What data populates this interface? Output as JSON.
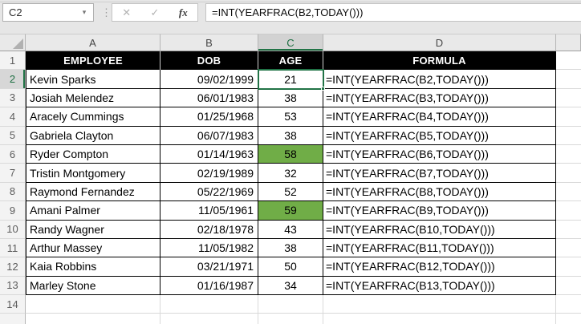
{
  "formula_bar": {
    "name_box_value": "C2",
    "formula": "=INT(YEARFRAC(B2,TODAY()))",
    "icons": {
      "dropdown": "▾",
      "dots": "⋮",
      "cancel": "✕",
      "enter": "✓",
      "fx": "fx"
    }
  },
  "sheet": {
    "selected_cell": "C2",
    "selected_column": "C",
    "selected_row": "2",
    "column_letters": [
      "A",
      "B",
      "C",
      "D"
    ],
    "header_row_number": "1",
    "table_headers": [
      "EMPLOYEE",
      "DOB",
      "AGE",
      "FORMULA"
    ],
    "rows": [
      {
        "n": "2",
        "name": "Kevin Sparks",
        "dob": "09/02/1999",
        "age": "21",
        "formula": "=INT(YEARFRAC(B2,TODAY()))",
        "highlighted": false,
        "selected": true
      },
      {
        "n": "3",
        "name": "Josiah Melendez",
        "dob": "06/01/1983",
        "age": "38",
        "formula": "=INT(YEARFRAC(B3,TODAY()))",
        "highlighted": false
      },
      {
        "n": "4",
        "name": "Aracely Cummings",
        "dob": "01/25/1968",
        "age": "53",
        "formula": "=INT(YEARFRAC(B4,TODAY()))",
        "highlighted": false
      },
      {
        "n": "5",
        "name": "Gabriela Clayton",
        "dob": "06/07/1983",
        "age": "38",
        "formula": "=INT(YEARFRAC(B5,TODAY()))",
        "highlighted": false
      },
      {
        "n": "6",
        "name": "Ryder Compton",
        "dob": "01/14/1963",
        "age": "58",
        "formula": "=INT(YEARFRAC(B6,TODAY()))",
        "highlighted": true
      },
      {
        "n": "7",
        "name": "Tristin Montgomery",
        "dob": "02/19/1989",
        "age": "32",
        "formula": "=INT(YEARFRAC(B7,TODAY()))",
        "highlighted": false
      },
      {
        "n": "8",
        "name": "Raymond Fernandez",
        "dob": "05/22/1969",
        "age": "52",
        "formula": "=INT(YEARFRAC(B8,TODAY()))",
        "highlighted": false
      },
      {
        "n": "9",
        "name": "Amani Palmer",
        "dob": "11/05/1961",
        "age": "59",
        "formula": "=INT(YEARFRAC(B9,TODAY()))",
        "highlighted": true
      },
      {
        "n": "10",
        "name": "Randy Wagner",
        "dob": "02/18/1978",
        "age": "43",
        "formula": "=INT(YEARFRAC(B10,TODAY()))",
        "highlighted": false
      },
      {
        "n": "11",
        "name": "Arthur Massey",
        "dob": "11/05/1982",
        "age": "38",
        "formula": "=INT(YEARFRAC(B11,TODAY()))",
        "highlighted": false
      },
      {
        "n": "12",
        "name": "Kaia Robbins",
        "dob": "03/21/1971",
        "age": "50",
        "formula": "=INT(YEARFRAC(B12,TODAY()))",
        "highlighted": false
      },
      {
        "n": "13",
        "name": "Marley Stone",
        "dob": "01/16/1987",
        "age": "34",
        "formula": "=INT(YEARFRAC(B13,TODAY()))",
        "highlighted": false
      }
    ],
    "empty_row_number": "14",
    "colors": {
      "highlight_green": "#70AD47",
      "selection_green": "#217346",
      "table_header_bg": "#000000",
      "table_header_text": "#FFFFFF"
    }
  }
}
